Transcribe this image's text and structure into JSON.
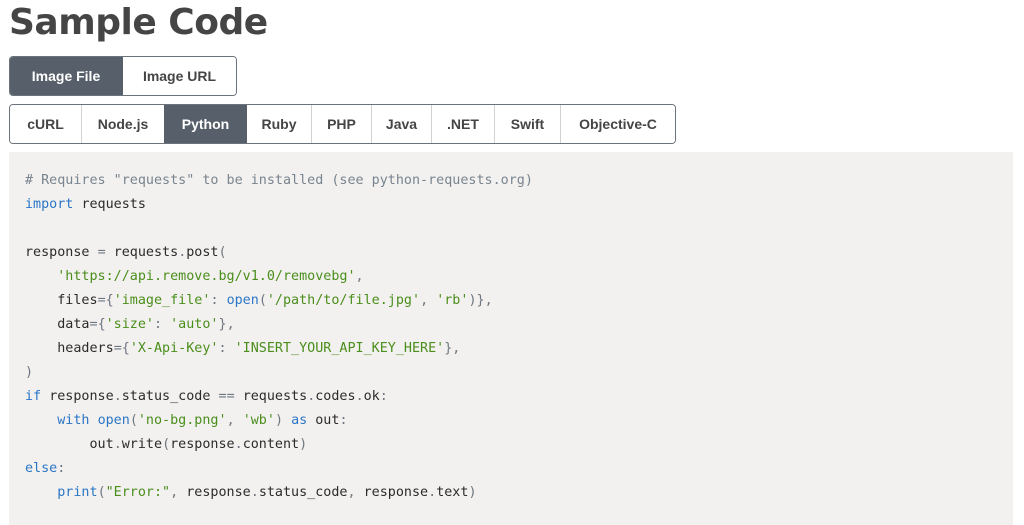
{
  "page": {
    "title": "Sample Code"
  },
  "source_tabs": [
    {
      "label": "Image File",
      "active": true
    },
    {
      "label": "Image URL",
      "active": false
    }
  ],
  "language_tabs": [
    {
      "label": "cURL",
      "active": false
    },
    {
      "label": "Node.js",
      "active": false
    },
    {
      "label": "Python",
      "active": true
    },
    {
      "label": "Ruby",
      "active": false
    },
    {
      "label": "PHP",
      "active": false
    },
    {
      "label": "Java",
      "active": false
    },
    {
      "label": ".NET",
      "active": false
    },
    {
      "label": "Swift",
      "active": false
    },
    {
      "label": "Objective-C",
      "active": false
    }
  ],
  "code": {
    "language": "python",
    "lines": [
      "# Requires \"requests\" to be installed (see python-requests.org)",
      "import requests",
      "",
      "response = requests.post(",
      "    'https://api.remove.bg/v1.0/removebg',",
      "    files={'image_file': open('/path/to/file.jpg', 'rb')},",
      "    data={'size': 'auto'},",
      "    headers={'X-Api-Key': 'INSERT_YOUR_API_KEY_HERE'},",
      ")",
      "if response.status_code == requests.codes.ok:",
      "    with open('no-bg.png', 'wb') as out:",
      "        out.write(response.content)",
      "else:",
      "    print(\"Error:\", response.status_code, response.text)"
    ]
  },
  "colors": {
    "active_tab_bg": "#57606a",
    "code_bg": "#f3f1ef",
    "keyword": "#2a76c6",
    "string": "#4a8e1c",
    "comment": "#78848f",
    "title": "#454545"
  }
}
